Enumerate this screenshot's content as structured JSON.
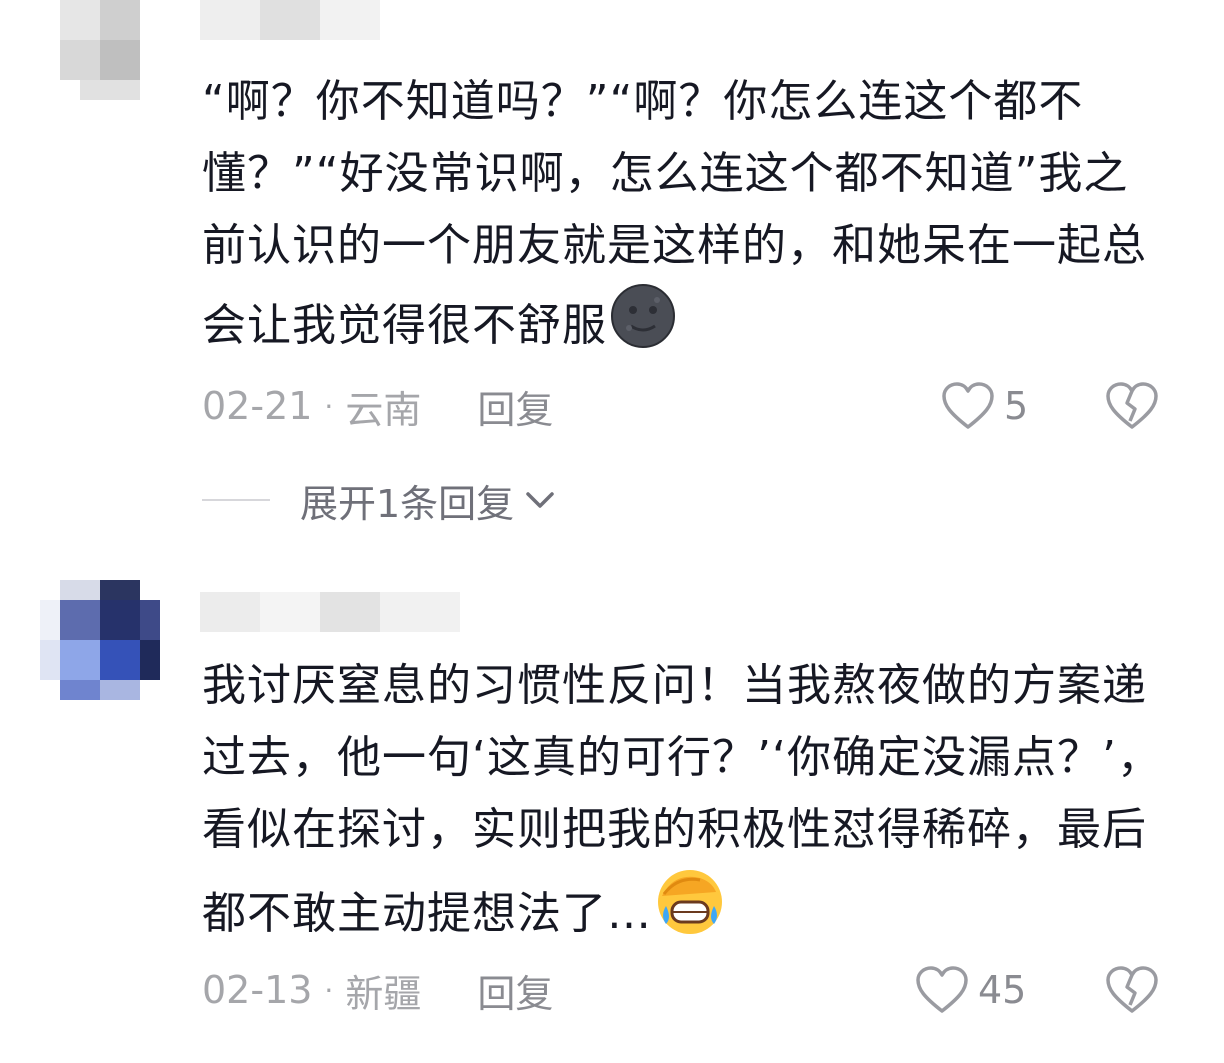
{
  "comments": [
    {
      "text": "“啊？你不知道吗？”“啊？你怎么连这个都不懂？”“好没常识啊，怎么连这个都不知道”我之前认识的一个朋友就是这样的，和她呆在一起总会让我觉得很不舒服",
      "emoji": "new-moon-face-emoji",
      "date": "02-21",
      "separator": "·",
      "location": "云南",
      "reply_label": "回复",
      "likes": "5",
      "expand_label": "展开1条回复"
    },
    {
      "text": "我讨厌窒息的习惯性反问！当我熬夜做的方案递过去，他一句‘这真的可行？’‘你确定没漏点？’，看似在探讨，实则把我的积极性怼得稀碎，最后都不敢主动提想法了…",
      "emoji": "grimacing-facepalm-emoji",
      "date": "02-13",
      "separator": "·",
      "location": "新疆",
      "reply_label": "回复",
      "likes": "45"
    }
  ],
  "colors": {
    "text": "#161823",
    "meta": "#a5a6aa",
    "reply": "#8a8b91"
  }
}
